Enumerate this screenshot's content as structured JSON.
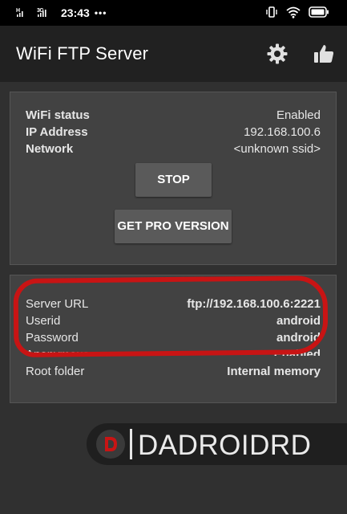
{
  "status_bar": {
    "signal1": "H\nıll",
    "signal2": "3G\nıll",
    "time": "23:43",
    "dots": "•••"
  },
  "app_bar": {
    "title": "WiFi FTP Server"
  },
  "wifi_card": {
    "rows": [
      {
        "label": "WiFi status",
        "value": "Enabled"
      },
      {
        "label": "IP Address",
        "value": "192.168.100.6"
      },
      {
        "label": "Network",
        "value": "<unknown ssid>"
      }
    ],
    "stop_button": "STOP",
    "pro_button": "GET PRO VERSION"
  },
  "server_card": {
    "rows": [
      {
        "label": "Server URL",
        "value": "ftp://192.168.100.6:2221"
      },
      {
        "label": "Userid",
        "value": "android"
      },
      {
        "label": "Password",
        "value": "android"
      },
      {
        "label": "Anonymous access",
        "value": "Enabled"
      },
      {
        "label": "Root folder",
        "value": "Internal memory"
      }
    ]
  },
  "watermark": {
    "text": "DADROIDRD"
  },
  "colors": {
    "background": "#303030",
    "app_bar": "#212121",
    "card": "#424242",
    "button": "#5a5a5a",
    "annotation_red": "#c81414"
  }
}
